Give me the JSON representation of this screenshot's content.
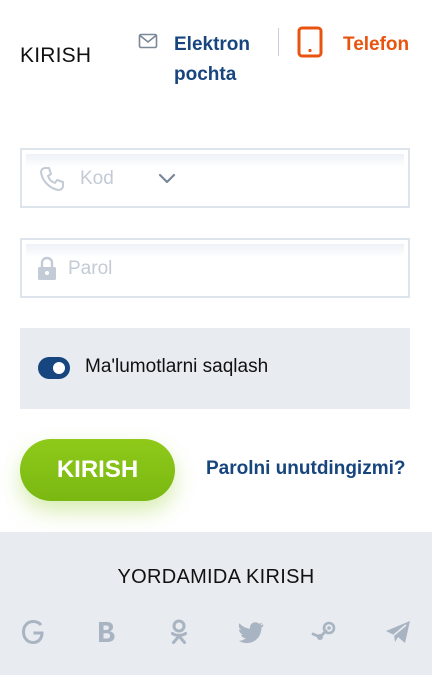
{
  "header": {
    "title": "KIRISH",
    "tab_email": {
      "line1": "Elektron",
      "line2": "pochta"
    },
    "tab_phone": "Telefon"
  },
  "form": {
    "code_placeholder": "Kod",
    "password_placeholder": "Parol",
    "remember_label": "Ma'lumotlarni saqlash",
    "remember_on": true,
    "submit_label": "KIRISH",
    "forgot_label": "Parolni unutdingizmi?"
  },
  "social": {
    "title": "YORDAMIDA KIRISH",
    "icons": [
      "google-icon",
      "b-icon",
      "odnoklassniki-icon",
      "twitter-icon",
      "steam-icon",
      "telegram-icon"
    ]
  },
  "colors": {
    "accent_blue": "#17457e",
    "accent_orange": "#e8540f",
    "accent_green": "#84c115",
    "panel_gray": "#e8ebf0"
  }
}
